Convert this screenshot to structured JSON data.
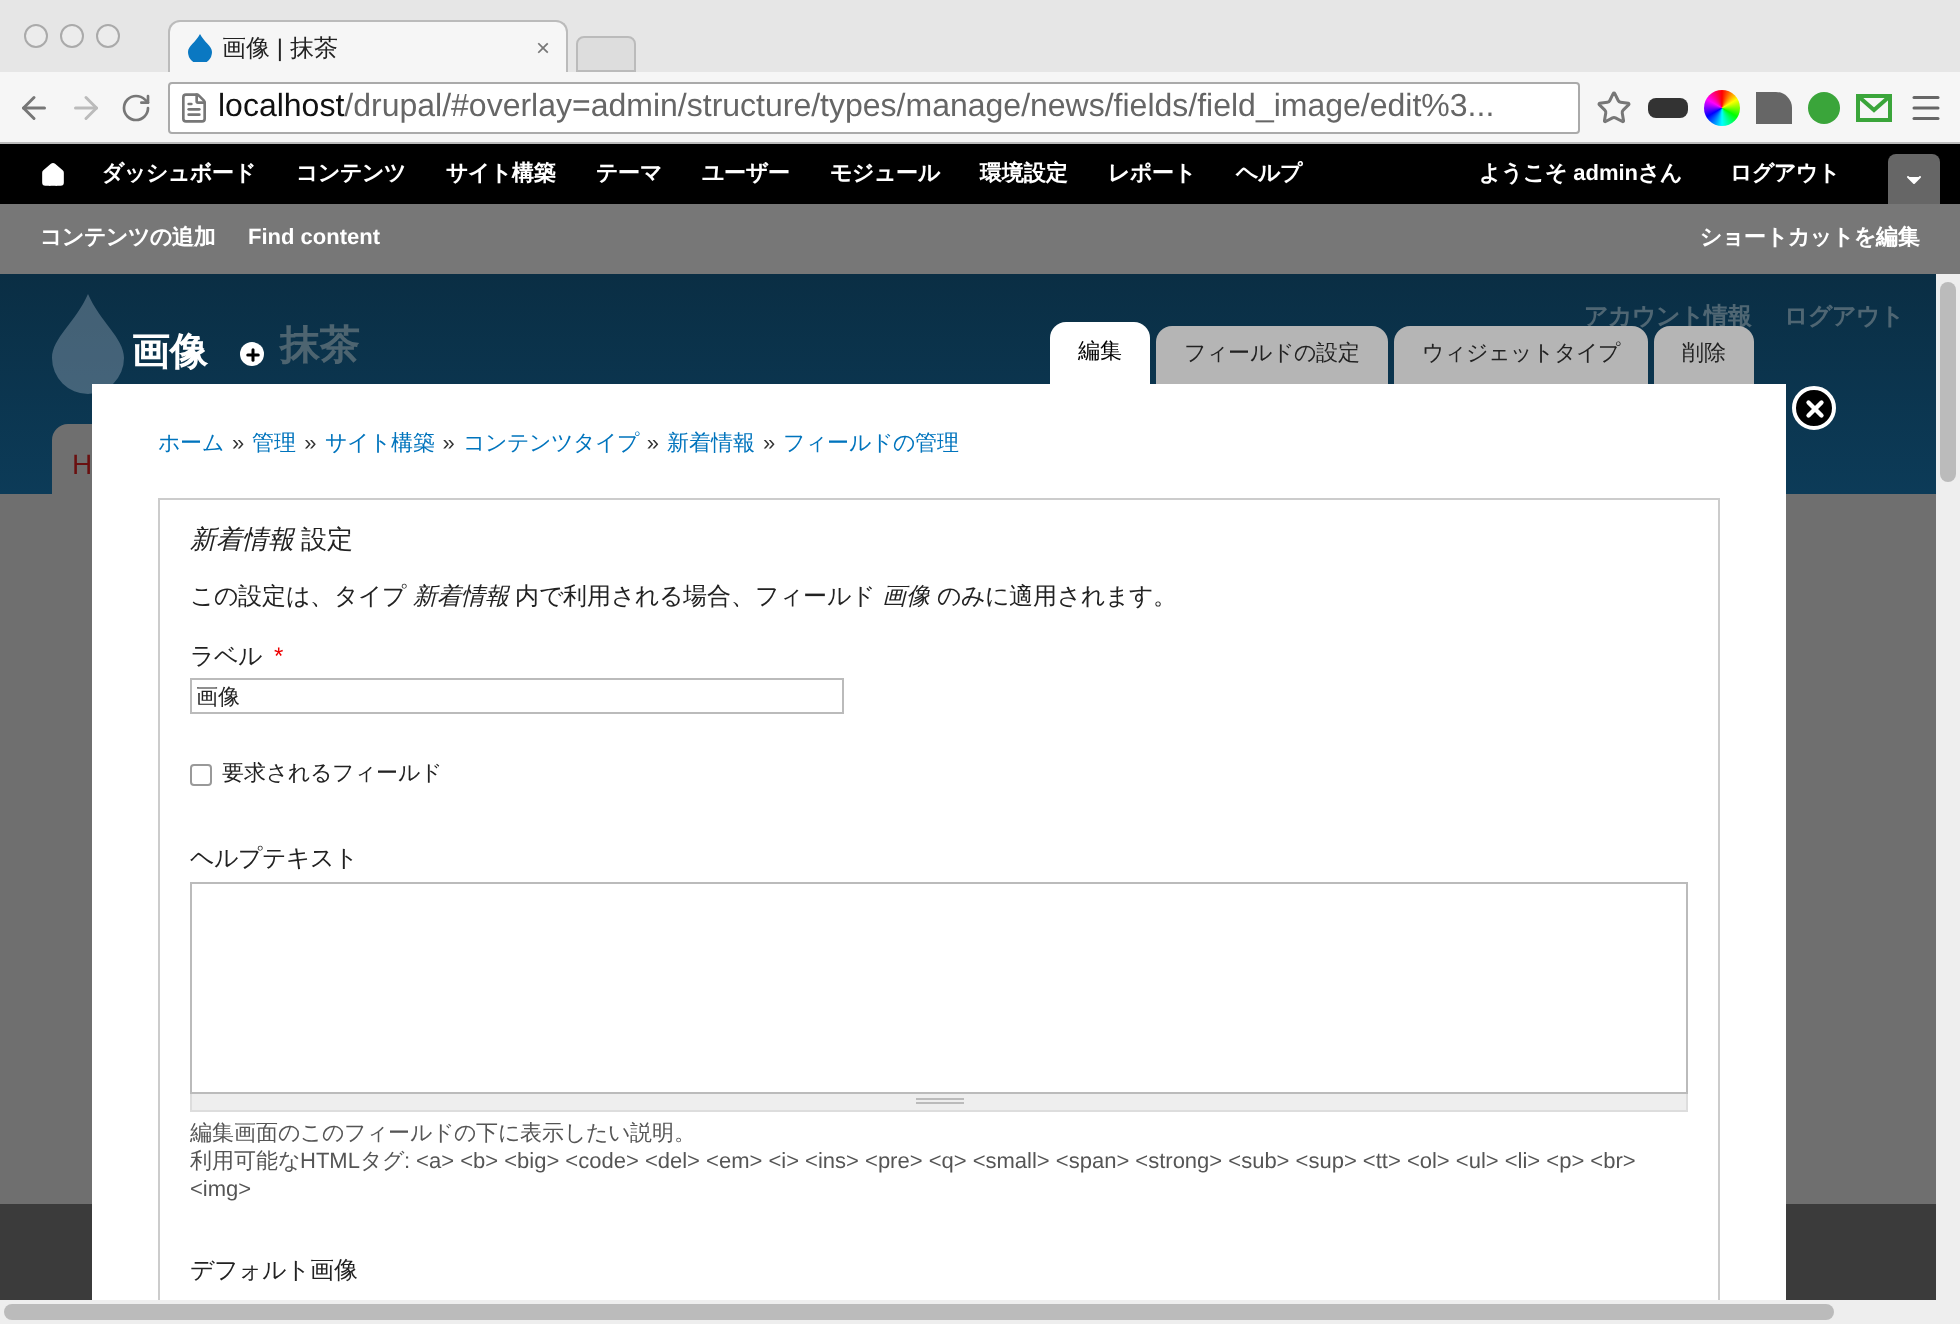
{
  "browser": {
    "tab_title": "画像 | 抹茶",
    "tab_close": "×",
    "url_host": "localhost",
    "url_path": "/drupal/#overlay=admin/structure/types/manage/news/fields/field_image/edit%3..."
  },
  "toolbar": {
    "items": [
      {
        "label": "ダッシュボード"
      },
      {
        "label": "コンテンツ"
      },
      {
        "label": "サイト構築"
      },
      {
        "label": "テーマ"
      },
      {
        "label": "ユーザー"
      },
      {
        "label": "モジュール"
      },
      {
        "label": "環境設定"
      },
      {
        "label": "レポート"
      },
      {
        "label": "ヘルプ"
      }
    ],
    "welcome": "ようこそ adminさん",
    "logout": "ログアウト"
  },
  "shortcuts": {
    "items": [
      "コンテンツの追加",
      "Find content"
    ],
    "edit": "ショートカットを編集"
  },
  "background_page": {
    "site_name": "抹茶",
    "account_links": [
      "アカウント情報",
      "ログアウト"
    ],
    "tab_fragment": "H"
  },
  "overlay": {
    "title": "画像",
    "tabs": [
      {
        "label": "編集",
        "selected": true
      },
      {
        "label": "フィールドの設定",
        "selected": false
      },
      {
        "label": "ウィジェットタイプ",
        "selected": false
      },
      {
        "label": "削除",
        "selected": false
      }
    ],
    "breadcrumb": [
      "ホーム",
      "管理",
      "サイト構築",
      "コンテンツタイプ",
      "新着情報",
      "フィールドの管理"
    ],
    "breadcrumb_separator": "»",
    "fieldset_legend": "*新着情報* 設定",
    "description": "この設定は、タイプ *新着情報* 内で利用される場合、フィールド *画像* のみに適用されます。",
    "label_field": {
      "label": "ラベル",
      "required_mark": "*",
      "value": "画像"
    },
    "required_checkbox": {
      "label": "要求されるフィールド",
      "checked": false
    },
    "help_text": {
      "label": "ヘルプテキスト",
      "hints": [
        "編集画面のこのフィールドの下に表示したい説明。",
        "利用可能なHTMLタグ: <a> <b> <big> <code> <del> <em> <i> <ins> <pre> <q> <small> <span> <strong> <sub> <sup> <tt> <ol> <ul> <li> <p> <br> <img>"
      ]
    },
    "default_image": {
      "label": "デフォルト画像"
    }
  }
}
